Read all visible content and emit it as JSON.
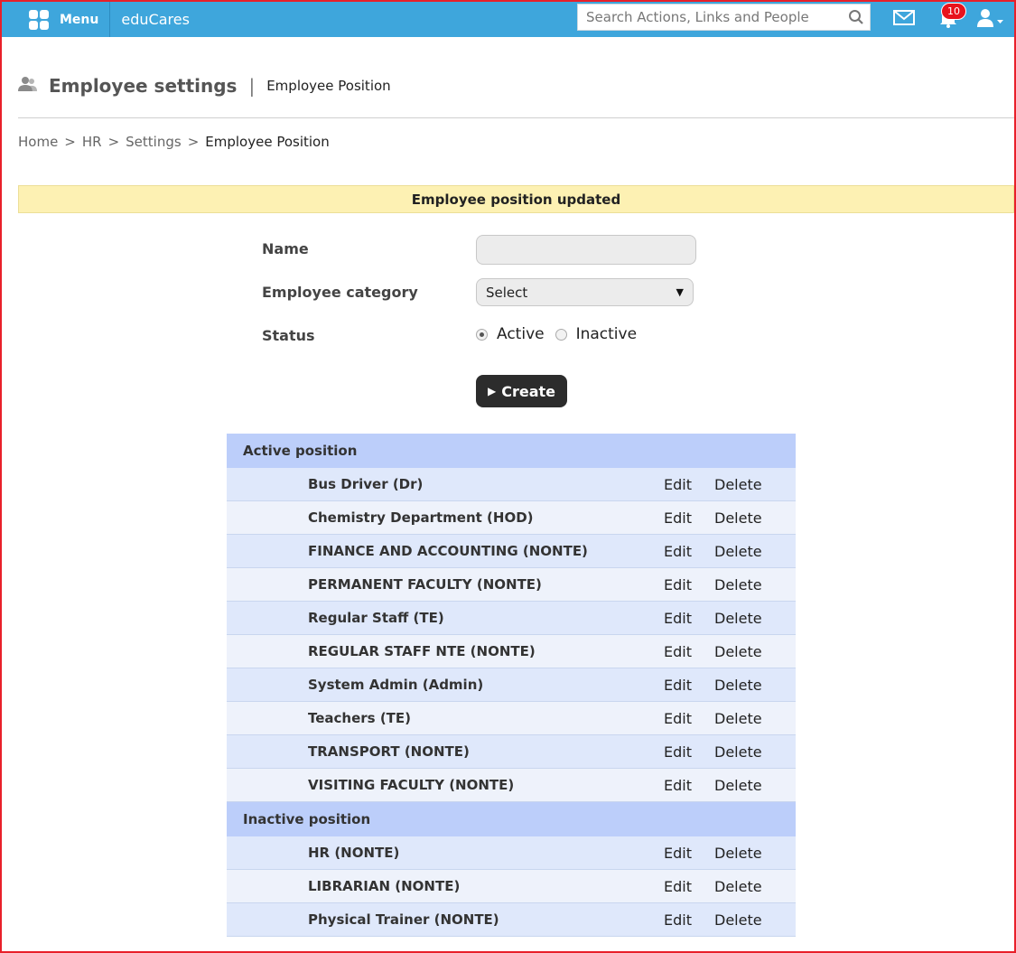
{
  "topbar": {
    "menu_label": "Menu",
    "brand": "eduCares",
    "search_placeholder": "Search Actions, Links and People",
    "notification_count": "10",
    "color": "#3ea6dc"
  },
  "header": {
    "title": "Employee settings",
    "separator": "|",
    "subtitle": "Employee Position"
  },
  "breadcrumb": {
    "home": "Home",
    "hr": "HR",
    "settings": "Settings",
    "current": "Employee Position",
    "sep": ">"
  },
  "alert": {
    "message": "Employee position updated"
  },
  "form": {
    "name_label": "Name",
    "name_value": "",
    "category_label": "Employee category",
    "category_value": "Select",
    "status_label": "Status",
    "status_active": "Active",
    "status_inactive": "Inactive",
    "status_selected": "Active",
    "create_label": "Create"
  },
  "actions": {
    "edit": "Edit",
    "delete": "Delete"
  },
  "active_section": {
    "title": "Active position",
    "items": [
      "Bus Driver (Dr)",
      "Chemistry Department (HOD)",
      "FINANCE AND ACCOUNTING (NONTE)",
      "PERMANENT FACULTY (NONTE)",
      "Regular Staff (TE)",
      "REGULAR STAFF NTE (NONTE)",
      "System Admin (Admin)",
      "Teachers (TE)",
      "TRANSPORT (NONTE)",
      "VISITING FACULTY (NONTE)"
    ]
  },
  "inactive_section": {
    "title": "Inactive position",
    "items": [
      "HR (NONTE)",
      "LIBRARIAN (NONTE)",
      "Physical Trainer (NONTE)"
    ]
  }
}
